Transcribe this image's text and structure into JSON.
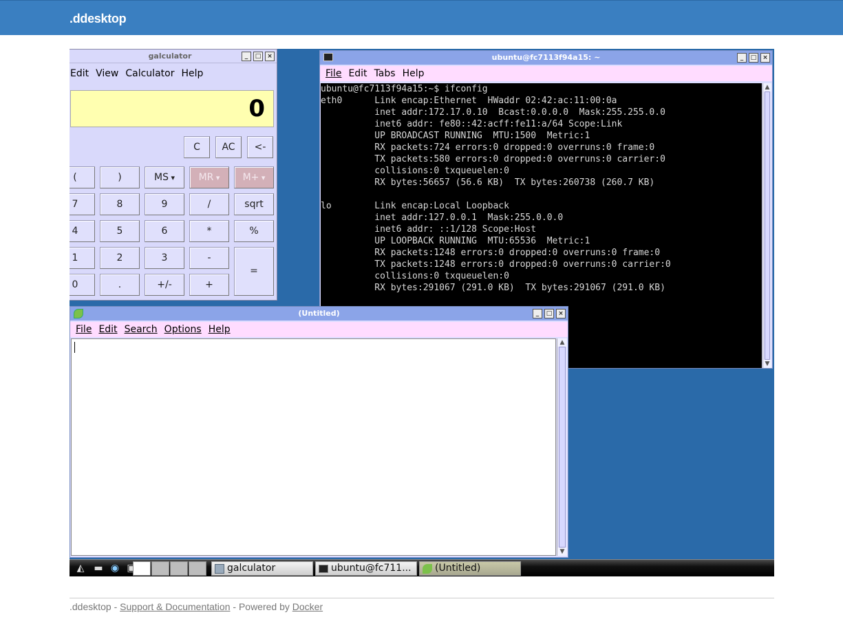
{
  "header": {
    "brand": ".ddesktop"
  },
  "calculator": {
    "title": "galculator",
    "menu": [
      "Edit",
      "View",
      "Calculator",
      "Help"
    ],
    "display": "0",
    "buttons": {
      "c": "C",
      "ac": "AC",
      "back": "<-",
      "lparen": "(",
      "rparen": ")",
      "ms": "MS",
      "mr": "MR",
      "mplus": "M+",
      "n7": "7",
      "n8": "8",
      "n9": "9",
      "div": "/",
      "sqrt": "sqrt",
      "n4": "4",
      "n5": "5",
      "n6": "6",
      "mul": "*",
      "pct": "%",
      "n1": "1",
      "n2": "2",
      "n3": "3",
      "minus": "-",
      "eq": "=",
      "n0": "0",
      "dot": ".",
      "neg": "+/-",
      "plus": "+"
    }
  },
  "terminal": {
    "title": "ubuntu@fc7113f94a15: ~",
    "menu": [
      "File",
      "Edit",
      "Tabs",
      "Help"
    ],
    "output": "ubuntu@fc7113f94a15:~$ ifconfig\neth0      Link encap:Ethernet  HWaddr 02:42:ac:11:00:0a\n          inet addr:172.17.0.10  Bcast:0.0.0.0  Mask:255.255.0.0\n          inet6 addr: fe80::42:acff:fe11:a/64 Scope:Link\n          UP BROADCAST RUNNING  MTU:1500  Metric:1\n          RX packets:724 errors:0 dropped:0 overruns:0 frame:0\n          TX packets:580 errors:0 dropped:0 overruns:0 carrier:0\n          collisions:0 txqueuelen:0\n          RX bytes:56657 (56.6 KB)  TX bytes:260738 (260.7 KB)\n\nlo        Link encap:Local Loopback\n          inet addr:127.0.0.1  Mask:255.0.0.0\n          inet6 addr: ::1/128 Scope:Host\n          UP LOOPBACK RUNNING  MTU:65536  Metric:1\n          RX packets:1248 errors:0 dropped:0 overruns:0 frame:0\n          TX packets:1248 errors:0 dropped:0 overruns:0 carrier:0\n          collisions:0 txqueuelen:0\n          RX bytes:291067 (291.0 KB)  TX bytes:291067 (291.0 KB)"
  },
  "editor": {
    "title": "(Untitled)",
    "menu": [
      "File",
      "Edit",
      "Search",
      "Options",
      "Help"
    ],
    "content": ""
  },
  "taskbar": {
    "items": [
      {
        "label": "galculator",
        "icon": "calculator-icon"
      },
      {
        "label": "ubuntu@fc711...",
        "icon": "terminal-icon"
      },
      {
        "label": "(Untitled)",
        "icon": "leafpad-icon"
      }
    ]
  },
  "footer": {
    "brand": ".ddesktop",
    "sep1": " - ",
    "support_link": "Support & Documentation",
    "sep2": " - Powered by ",
    "docker_link": "Docker"
  },
  "colors": {
    "topbar": "#3a7fc1",
    "desktop": "#2a6aa9",
    "display": "#ffffb0",
    "titlebar_active": "#8ba4e8"
  }
}
